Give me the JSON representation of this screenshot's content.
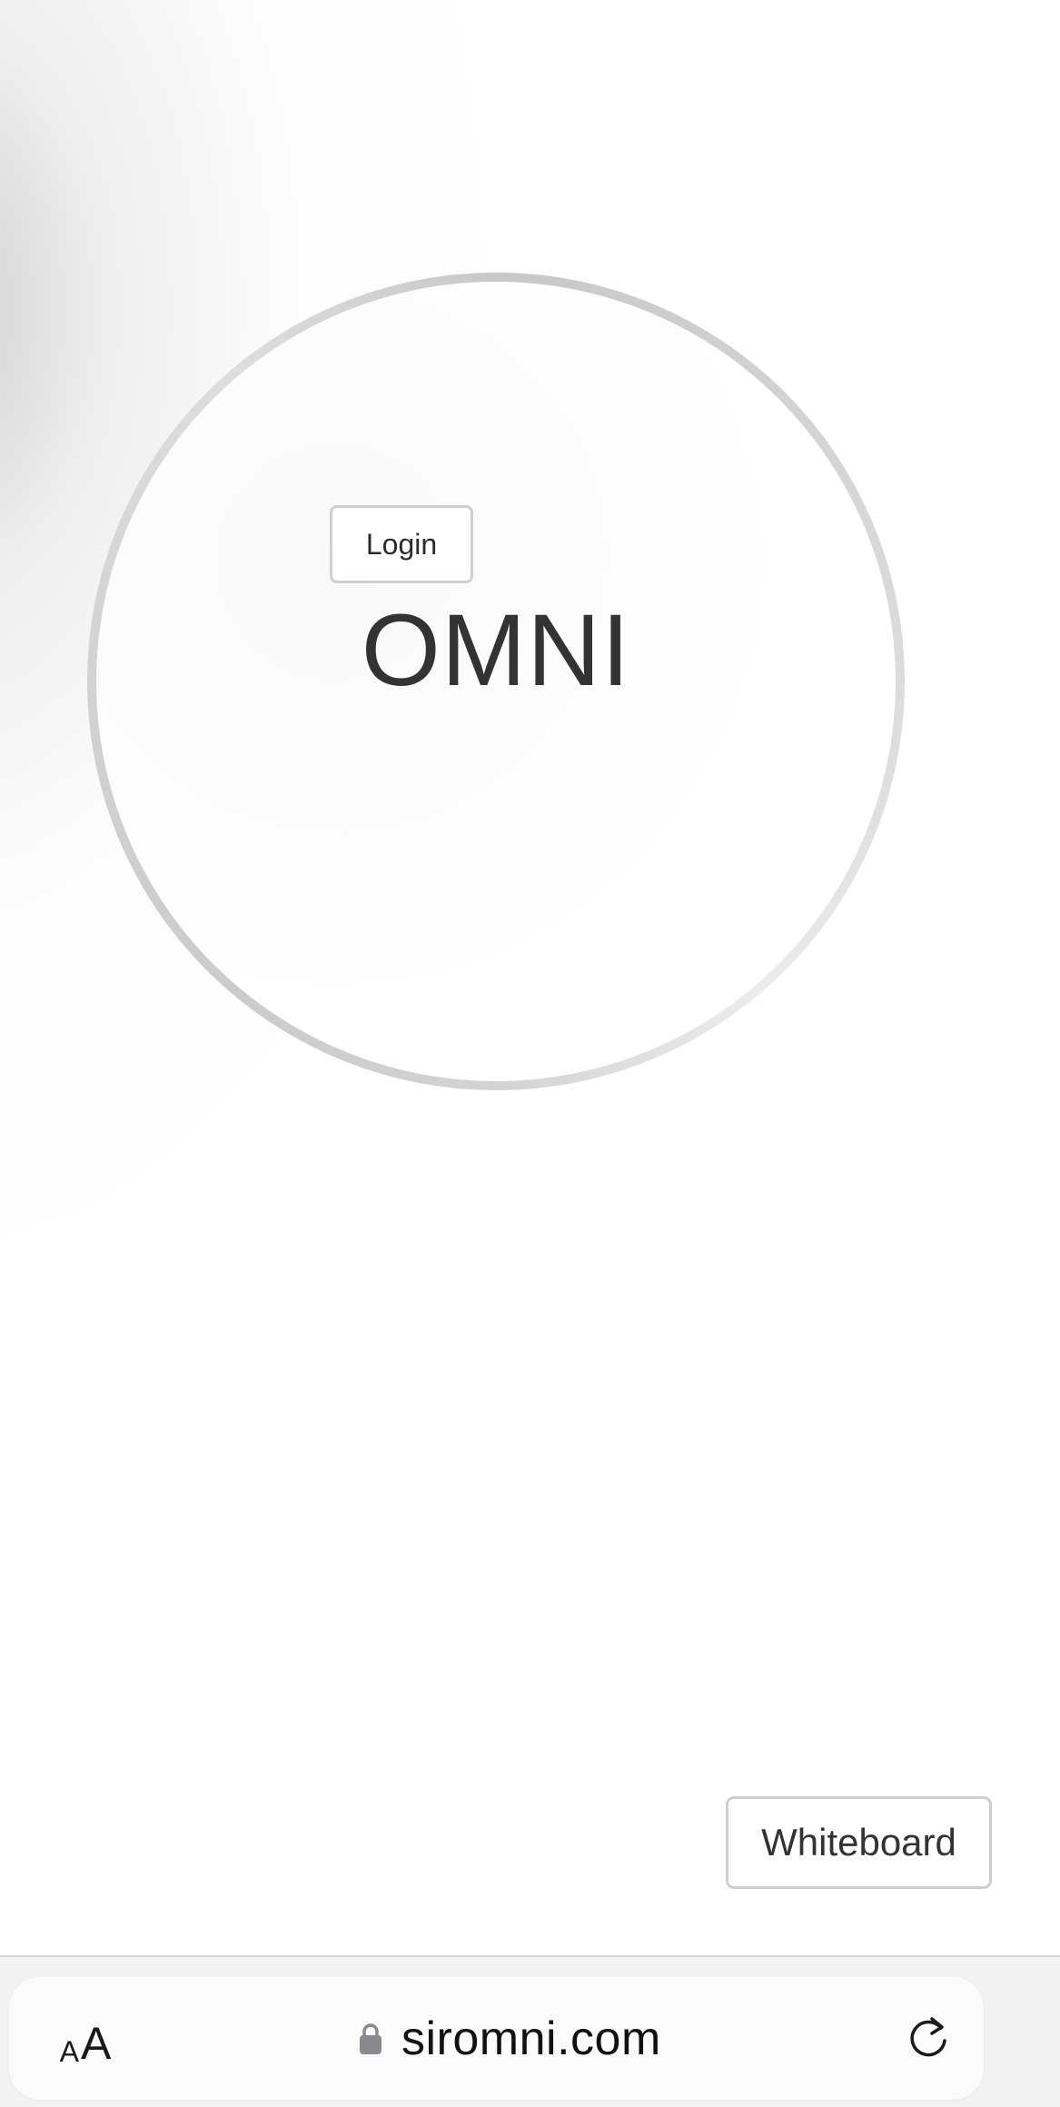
{
  "hero": {
    "title": "OMNI",
    "login_label": "Login"
  },
  "actions": {
    "whiteboard_label": "Whiteboard"
  },
  "browser": {
    "text_size_small": "A",
    "text_size_large": "A",
    "url": "siromni.com",
    "icons": {
      "lock": "lock-icon",
      "reload": "reload-icon"
    }
  },
  "colors": {
    "title_text": "#333333",
    "button_border": "#cfcfcf",
    "circle_ring": "#cccccc",
    "browser_bar_bg": "#f3f3f3",
    "address_pill_bg": "#fbfbfb",
    "lock_icon": "#8a8a8e"
  }
}
